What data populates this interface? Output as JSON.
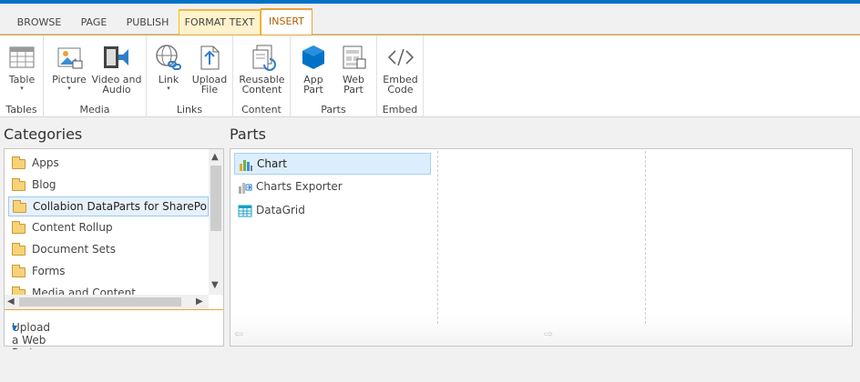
{
  "tabs": [
    "BROWSE",
    "PAGE",
    "PUBLISH",
    "FORMAT TEXT",
    "INSERT"
  ],
  "ribbon": {
    "groups": {
      "tables": "Tables",
      "media": "Media",
      "links": "Links",
      "content": "Content",
      "parts": "Parts",
      "embed": "Embed"
    },
    "buttons": {
      "table": "Table",
      "picture": "Picture",
      "video_1": "Video and",
      "video_2": "Audio",
      "link": "Link",
      "upload_1": "Upload",
      "upload_2": "File",
      "reusable_1": "Reusable",
      "reusable_2": "Content",
      "app_1": "App",
      "app_2": "Part",
      "web_1": "Web",
      "web_2": "Part",
      "embed_1": "Embed",
      "embed_2": "Code"
    },
    "dropdown_arrow": "▾",
    "colors": {
      "accent": "#e8a33b",
      "brand": "#0072c6",
      "selected": "#dceefc"
    }
  },
  "categories": {
    "title": "Categories",
    "items": [
      "Apps",
      "Blog",
      "Collabion DataParts for SharePoint",
      "Content Rollup",
      "Document Sets",
      "Forms",
      "Media and Content"
    ],
    "selected": "Collabion DataParts for SharePoint",
    "upload_label": "Upload a Web Part",
    "upload_arrow": "▾",
    "scroll": {
      "up": "▲",
      "down": "▼",
      "left": "◀",
      "right": "▶"
    }
  },
  "parts": {
    "title": "Parts",
    "items": [
      "Chart",
      "Charts Exporter",
      "DataGrid"
    ],
    "selected": "Chart",
    "nav_prev": "⇦",
    "nav_next": "⇨"
  }
}
